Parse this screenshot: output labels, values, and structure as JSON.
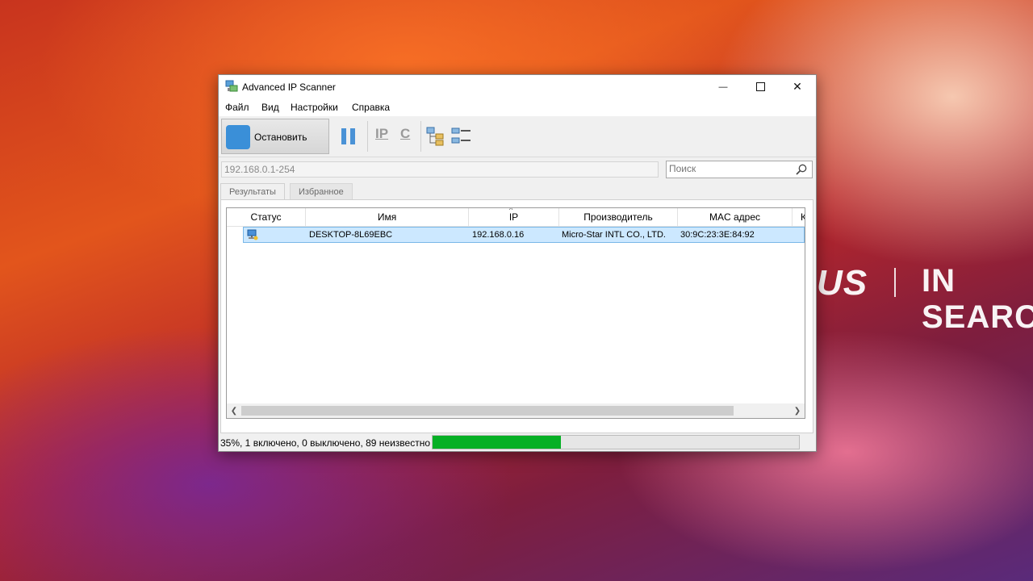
{
  "wallpaper": {
    "logo_text": "US",
    "slogan": "IN SEARC"
  },
  "window": {
    "title": "Advanced IP Scanner",
    "controls": {
      "minimize": "—",
      "close": "✕"
    }
  },
  "menu": {
    "items": [
      {
        "label": "Файл"
      },
      {
        "label": "Вид"
      },
      {
        "label": "Настройки"
      },
      {
        "label": "Справка"
      }
    ]
  },
  "toolbar": {
    "stop_label": "Остановить",
    "ip_icon": "IP",
    "c_icon": "C",
    "icons": [
      "stop-icon",
      "pause-icon",
      "ip-icon",
      "c-icon",
      "expand-all-icon",
      "collapse-all-icon"
    ],
    "accent_color": "#3a8fd8"
  },
  "address": {
    "value": "192.168.0.1-254"
  },
  "search": {
    "placeholder": "Поиск"
  },
  "tabs": [
    {
      "label": "Результаты",
      "active": true
    },
    {
      "label": "Избранное",
      "active": false
    }
  ],
  "table": {
    "columns": [
      "Статус",
      "Имя",
      "IP",
      "Производитель",
      "MAC адрес",
      "К"
    ],
    "sorted_column": "IP",
    "rows": [
      {
        "status": "online",
        "name": "DESKTOP-8L69EBC",
        "ip": "192.168.0.16",
        "manufacturer": "Micro-Star INTL CO., LTD.",
        "mac": "30:9C:23:3E:84:92",
        "selected": true
      }
    ]
  },
  "status": {
    "text": "35%, 1 включено, 0 выключено, 89 неизвестно",
    "progress_percent": 35,
    "progress_color": "#06b025"
  }
}
